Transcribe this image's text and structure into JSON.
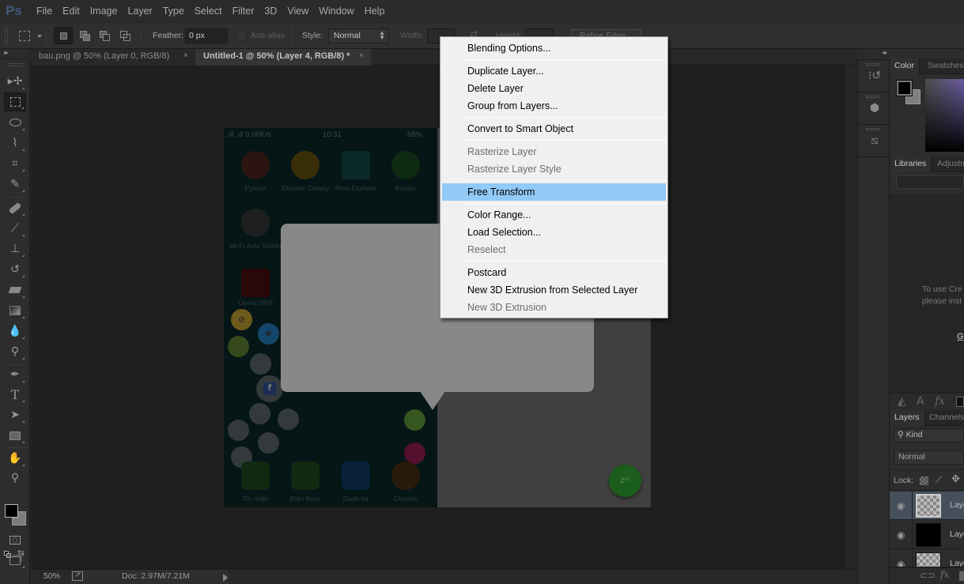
{
  "app": {
    "logo": "Ps"
  },
  "menubar": {
    "items": [
      "File",
      "Edit",
      "Image",
      "Layer",
      "Type",
      "Select",
      "Filter",
      "3D",
      "View",
      "Window",
      "Help"
    ]
  },
  "options_bar": {
    "feather_label": "Feather:",
    "feather_value": "0 px",
    "antialias_label": "Anti-alias",
    "style_label": "Style:",
    "style_value": "Normal",
    "width_label": "Width:",
    "height_label": "Height:",
    "refine_edge_label": "Refine Edge..."
  },
  "doc_tabs": [
    {
      "label": "bau.png @ 50% (Layer 0, RGB/8)",
      "active": false
    },
    {
      "label": "Untitled-1 @ 50% (Layer 4, RGB/8) *",
      "active": true
    }
  ],
  "tools": [
    "move-tool",
    "rectangular-marquee-tool",
    "lasso-tool",
    "quick-selection-tool",
    "crop-tool",
    "eyedropper-tool",
    "spot-healing-brush-tool",
    "brush-tool",
    "clone-stamp-tool",
    "history-brush-tool",
    "eraser-tool",
    "gradient-tool",
    "blur-tool",
    "dodge-tool",
    "pen-tool",
    "type-tool",
    "path-selection-tool",
    "rectangle-tool",
    "hand-tool",
    "zoom-tool"
  ],
  "colors": {
    "foreground": "#000000",
    "background": "#808080",
    "menu_highlight": "#91c9f7",
    "fab_green": "#1b5e1b"
  },
  "canvas": {
    "phone_status": {
      "left": ".ıll .ıll 0,00K/s",
      "time": "10:31",
      "battery": "68%"
    },
    "apps_row1": [
      "Pyrope",
      "Chrome Canary",
      "Root Explorer",
      "Boost+"
    ],
    "apps_row2": [
      "Wi-Fi Auto Starter"
    ],
    "apps_row3": [
      "Opera VPN"
    ],
    "dock_apps": [
      "Tin nhắn",
      "Điện thoại",
      "Danh bạ",
      "Chrome"
    ],
    "fab_label": "zᶻᶻ"
  },
  "status_bar": {
    "zoom": "50%",
    "doc_info": "Doc: 2.97M/7.21M"
  },
  "panels": {
    "color_tabs": [
      "Color",
      "Swatches"
    ],
    "library_tabs": [
      "Libraries",
      "Adjustm"
    ],
    "library_message_line1": "To use Cre",
    "library_message_line2": "please inst",
    "library_link": "G",
    "layers_tabs": [
      "Layers",
      "Channels"
    ],
    "kind_filter": "Kind",
    "blend_mode": "Normal",
    "lock_label": "Lock:",
    "layers": [
      {
        "name": "Laye",
        "thumb": "checker",
        "selected": true
      },
      {
        "name": "Laye",
        "thumb": "black",
        "selected": false
      },
      {
        "name": "Laye",
        "thumb": "screenshot",
        "selected": false
      }
    ]
  },
  "context_menu": {
    "items": [
      {
        "label": "Blending Options...",
        "disabled": false
      },
      {
        "label": "Duplicate Layer...",
        "disabled": false
      },
      {
        "label": "Delete Layer",
        "disabled": false
      },
      {
        "label": "Group from Layers...",
        "disabled": false
      },
      {
        "label": "Convert to Smart Object",
        "disabled": false
      },
      {
        "label": "Rasterize Layer",
        "disabled": true
      },
      {
        "label": "Rasterize Layer Style",
        "disabled": true
      },
      {
        "label": "Free Transform",
        "disabled": false,
        "highlighted": true
      },
      {
        "label": "Color Range...",
        "disabled": false
      },
      {
        "label": "Load Selection...",
        "disabled": false
      },
      {
        "label": "Reselect",
        "disabled": true
      },
      {
        "label": "Postcard",
        "disabled": false
      },
      {
        "label": "New 3D Extrusion from Selected Layer",
        "disabled": false
      },
      {
        "label": "New 3D Extrusion",
        "disabled": true
      }
    ]
  }
}
